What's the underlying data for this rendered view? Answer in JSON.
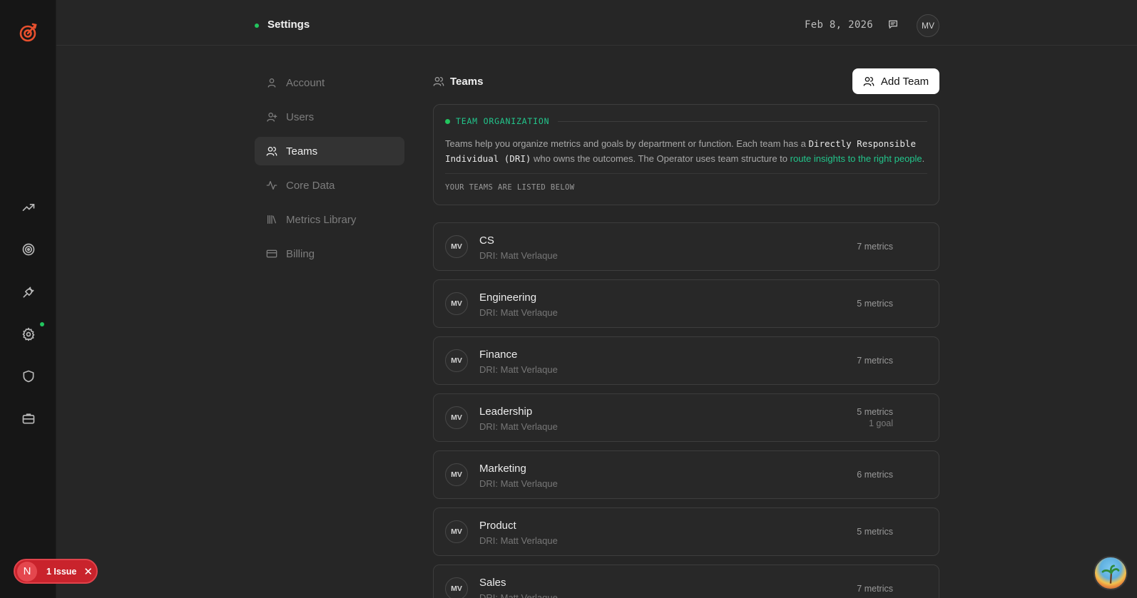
{
  "topbar": {
    "title": "Settings",
    "date": "Feb 8, 2026",
    "avatar_initials": "MV"
  },
  "subnav": {
    "items": [
      {
        "label": "Account",
        "icon": "user-icon"
      },
      {
        "label": "Users",
        "icon": "user-plus-icon"
      },
      {
        "label": "Teams",
        "icon": "users-icon",
        "active": true
      },
      {
        "label": "Core Data",
        "icon": "activity-icon"
      },
      {
        "label": "Metrics Library",
        "icon": "library-icon"
      },
      {
        "label": "Billing",
        "icon": "credit-card-icon"
      }
    ]
  },
  "main": {
    "section_title": "Teams",
    "add_button_label": "Add Team",
    "info": {
      "heading": "TEAM ORGANIZATION",
      "text_1": "Teams help you organize metrics and goals by department or function. Each team has a ",
      "mono": "Directly Responsible Individual (DRI)",
      "text_2": " who owns the outcomes. The Operator uses team structure to ",
      "link": "route insights to the right people",
      "text_3": ".",
      "footer": "YOUR TEAMS ARE LISTED BELOW"
    },
    "teams": [
      {
        "initials": "MV",
        "name": "CS",
        "dri": "DRI: Matt Verlaque",
        "metrics": "7 metrics",
        "goals": ""
      },
      {
        "initials": "MV",
        "name": "Engineering",
        "dri": "DRI: Matt Verlaque",
        "metrics": "5 metrics",
        "goals": ""
      },
      {
        "initials": "MV",
        "name": "Finance",
        "dri": "DRI: Matt Verlaque",
        "metrics": "7 metrics",
        "goals": ""
      },
      {
        "initials": "MV",
        "name": "Leadership",
        "dri": "DRI: Matt Verlaque",
        "metrics": "5 metrics",
        "goals": "1 goal"
      },
      {
        "initials": "MV",
        "name": "Marketing",
        "dri": "DRI: Matt Verlaque",
        "metrics": "6 metrics",
        "goals": ""
      },
      {
        "initials": "MV",
        "name": "Product",
        "dri": "DRI: Matt Verlaque",
        "metrics": "5 metrics",
        "goals": ""
      },
      {
        "initials": "MV",
        "name": "Sales",
        "dri": "DRI: Matt Verlaque",
        "metrics": "7 metrics",
        "goals": ""
      }
    ]
  },
  "issue_badge": {
    "letter": "N",
    "label": "1 Issue",
    "close": "✕"
  },
  "colors": {
    "accent_green": "#22c55e",
    "issue_red": "#c9232c",
    "logo_orange": "#e8502e"
  }
}
